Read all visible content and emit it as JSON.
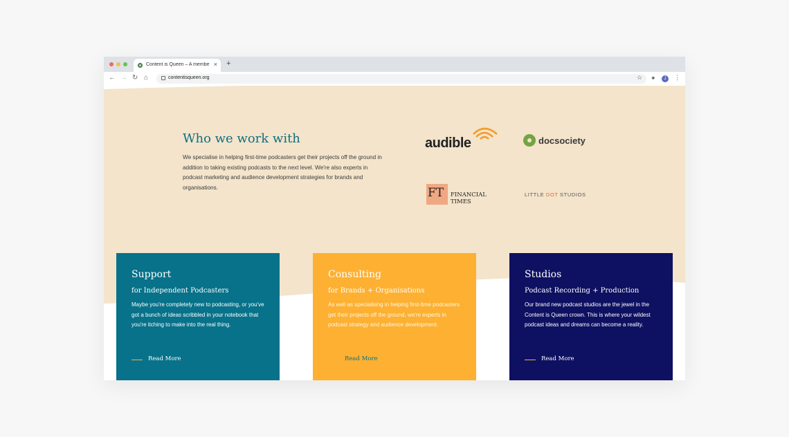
{
  "browser": {
    "tab_title": "Content is Queen – A membersh",
    "new_tab_symbol": "+",
    "close_symbol": "×",
    "url": "contentisqueen.org",
    "avatar_initial": "J"
  },
  "colors": {
    "beige": "#f3e4cb",
    "teal": "#07728a",
    "orange": "#fdb031",
    "navy": "#0e1061",
    "heading": "#0e6f80"
  },
  "clients": {
    "heading": "Who we work with",
    "intro": "We specialise in helping first-time podcasters get their projects off the ground in addition to taking existing podcasts to the next level. We're also experts in podcast marketing and audience development strategies for brands and organisations.",
    "logos": {
      "audible": "audible",
      "docsociety": "docsociety",
      "ft_mark": "FT",
      "ft_line1": "FINANCIAL",
      "ft_line2": "TIMES",
      "littledot_a": "LITTLE ",
      "littledot_b": "DOT",
      "littledot_c": " STUDIOS"
    }
  },
  "cards": [
    {
      "title": "Support",
      "subtitle": "for Independent Podcasters",
      "body": "Maybe you're completely new to podcasting, or you've got a bunch of ideas scribbled in your notebook that you're itching to make into the real thing.",
      "link": "Read More"
    },
    {
      "title": "Consulting",
      "subtitle": "for Brands + Organisations",
      "body": "As well as specialising in helping first-time podcasters get their projects off the ground, we're experts in podcast strategy and audience development.",
      "link": "Read More"
    },
    {
      "title": "Studios",
      "subtitle": "Podcast Recording + Production",
      "body": "Our brand new podcast studios are the jewel in the Content is Queen crown. This is where your wildest podcast ideas and dreams can become a reality.",
      "link": "Read More"
    }
  ]
}
